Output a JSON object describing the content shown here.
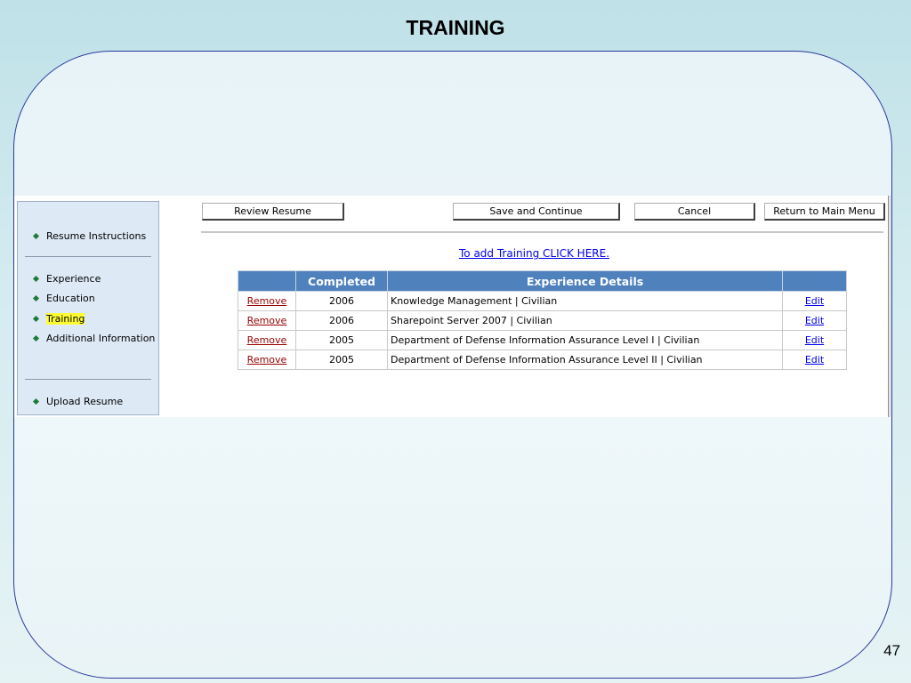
{
  "slide": {
    "title": "TRAINING",
    "number": "47"
  },
  "sidebar": {
    "items": [
      {
        "label": "Resume Instructions",
        "active": false
      },
      {
        "label": "Experience",
        "active": false
      },
      {
        "label": "Education",
        "active": false
      },
      {
        "label": "Training",
        "active": true
      },
      {
        "label": "Additional Information",
        "active": false
      },
      {
        "label": "Upload Resume",
        "active": false
      }
    ]
  },
  "toolbar": {
    "review_label": "Review Resume",
    "save_label": "Save and Continue",
    "cancel_label": "Cancel",
    "return_label": "Return to Main Menu"
  },
  "add_link": "To add Training CLICK HERE.",
  "table": {
    "headers": [
      "",
      "Completed",
      "Experience Details",
      ""
    ],
    "rows": [
      {
        "remove": "Remove",
        "year": "2006",
        "details": "Knowledge Management | Civilian",
        "edit": "Edit"
      },
      {
        "remove": "Remove",
        "year": "2006",
        "details": "Sharepoint Server 2007 | Civilian",
        "edit": "Edit"
      },
      {
        "remove": "Remove",
        "year": "2005",
        "details": "Department of Defense Information Assurance Level I | Civilian",
        "edit": "Edit"
      },
      {
        "remove": "Remove",
        "year": "2005",
        "details": "Department of Defense Information Assurance Level II | Civilian",
        "edit": "Edit"
      }
    ]
  },
  "colors": {
    "header_bg": "#4f81bd",
    "sidebar_bg": "#dde9f5",
    "active_highlight": "#ffff33",
    "bullet": "#1d7a38",
    "remove_link": "#990000",
    "edit_link": "#0000ee",
    "frame_border": "#2a3a9a"
  },
  "icons": {
    "nav_bullet": "diamond-bullet-icon"
  }
}
